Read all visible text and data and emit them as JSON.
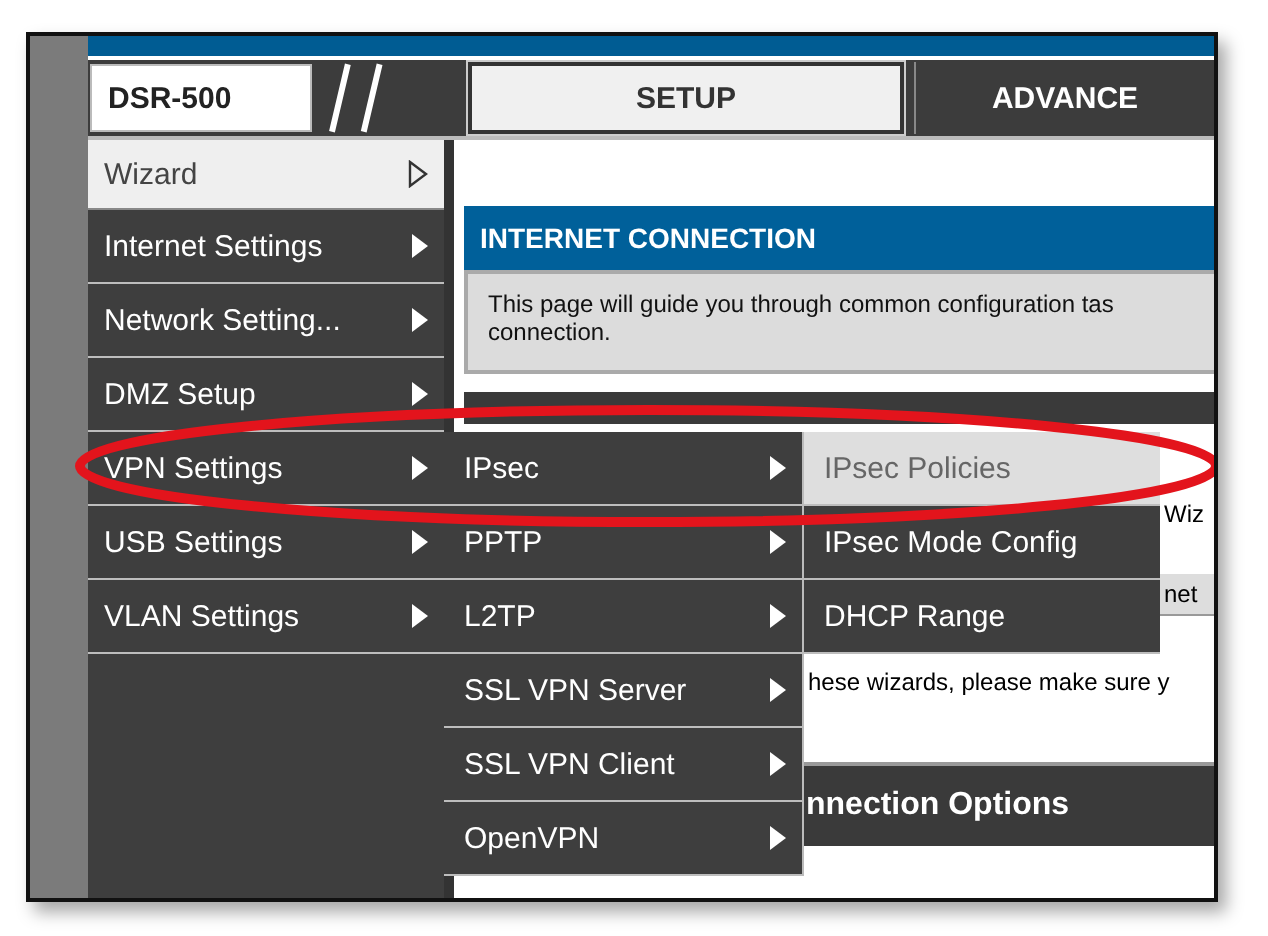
{
  "header": {
    "model": "DSR-500",
    "tabs": [
      {
        "label": "SETUP",
        "selected": true
      },
      {
        "label": "ADVANCE",
        "selected": false
      }
    ]
  },
  "sidebar": {
    "items": [
      {
        "label": "Wizard",
        "kind": "page"
      },
      {
        "label": "Internet Settings",
        "kind": "menu"
      },
      {
        "label": "Network Setting...",
        "kind": "menu"
      },
      {
        "label": "DMZ Setup",
        "kind": "menu"
      },
      {
        "label": "VPN Settings",
        "kind": "menu"
      },
      {
        "label": "USB Settings",
        "kind": "menu"
      },
      {
        "label": "VLAN Settings",
        "kind": "menu"
      }
    ]
  },
  "submenu": {
    "items": [
      {
        "label": "IPsec"
      },
      {
        "label": "PPTP"
      },
      {
        "label": "L2TP"
      },
      {
        "label": "SSL VPN Server"
      },
      {
        "label": "SSL VPN Client"
      },
      {
        "label": "OpenVPN"
      }
    ]
  },
  "submenu_2": {
    "items": [
      {
        "label": "IPsec Policies",
        "selected": true
      },
      {
        "label": "IPsec Mode Config",
        "selected": false
      },
      {
        "label": "DHCP Range",
        "selected": false
      }
    ]
  },
  "content": {
    "section_title": "INTERNET CONNECTION",
    "description_lines": [
      "This page will guide you through common configuration tas",
      "connection."
    ],
    "fragment": "Wiz",
    "button_fragment": "net",
    "note_fragment": "hese wizards, please make sure y",
    "options_title": "nnection Options"
  }
}
